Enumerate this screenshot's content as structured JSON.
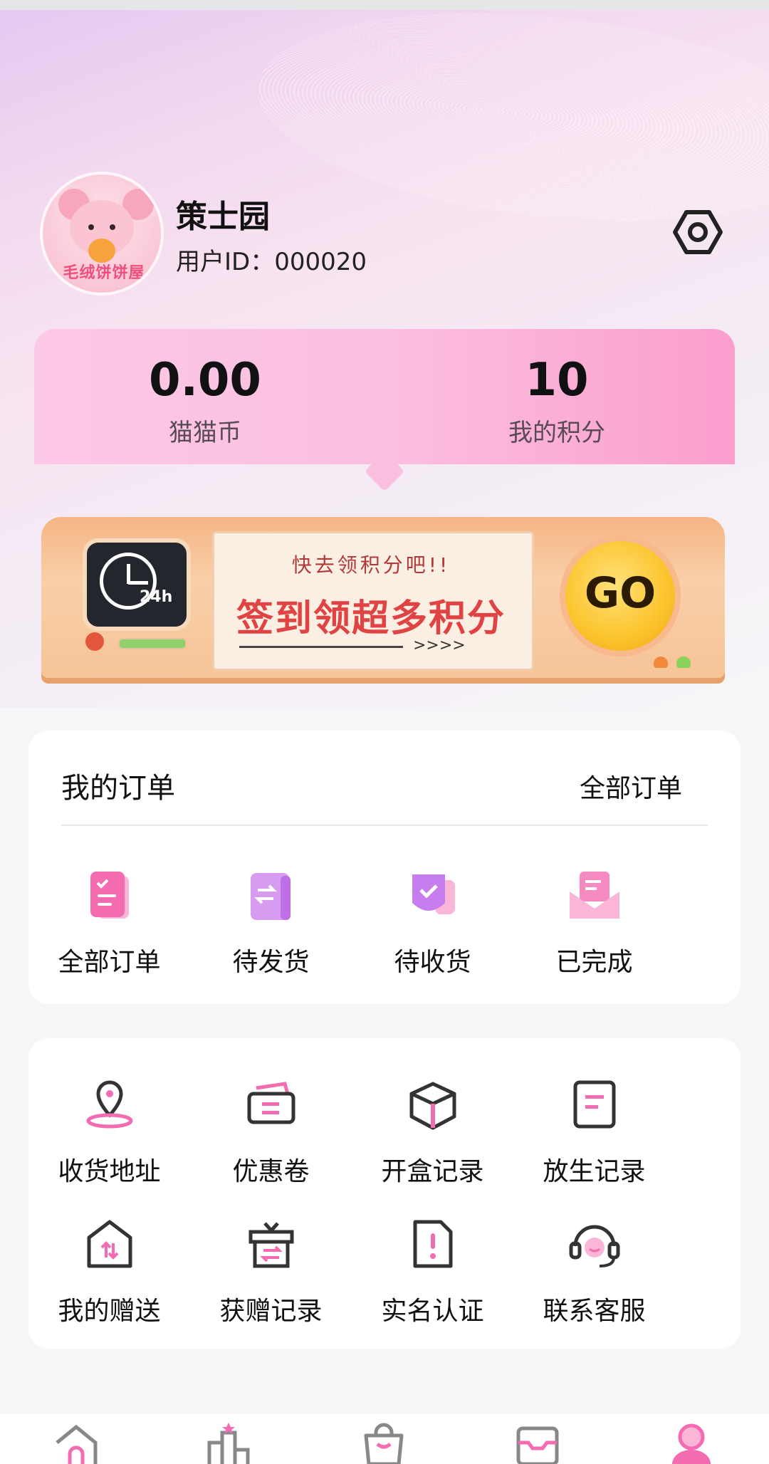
{
  "profile": {
    "name": "策士园",
    "user_id": "用户ID：000020",
    "avatar_text": "毛绒饼饼屋"
  },
  "stats": [
    {
      "value": "0.00",
      "label": "猫猫币"
    },
    {
      "value": "10",
      "label": "我的积分"
    }
  ],
  "banner": {
    "subtitle": "快去领积分吧!!",
    "title": "签到领超多积分",
    "arrows": ">>>>",
    "go_label": "GO",
    "clock_label": "24h"
  },
  "orders": {
    "title": "我的订单",
    "all_link": "全部订单",
    "items": [
      {
        "label": "全部订单",
        "icon": "clipboard-check-icon"
      },
      {
        "label": "待发货",
        "icon": "ship-box-icon"
      },
      {
        "label": "待收货",
        "icon": "receive-shield-icon"
      },
      {
        "label": "已完成",
        "icon": "envelope-done-icon"
      }
    ]
  },
  "services": [
    {
      "label": "收货地址",
      "icon": "location-pin-icon"
    },
    {
      "label": "优惠卷",
      "icon": "coupon-icon"
    },
    {
      "label": "开盒记录",
      "icon": "open-box-icon"
    },
    {
      "label": "放生记录",
      "icon": "document-icon"
    },
    {
      "label": "我的赠送",
      "icon": "gift-send-icon"
    },
    {
      "label": "获赠记录",
      "icon": "gift-received-icon"
    },
    {
      "label": "实名认证",
      "icon": "id-verify-icon"
    },
    {
      "label": "联系客服",
      "icon": "headset-icon"
    }
  ],
  "tabbar": [
    "home-icon",
    "rank-icon",
    "shop-bag-icon",
    "box-icon",
    "profile-icon"
  ],
  "colors": {
    "accent_pink": "#f36bb0",
    "stats_bg": "#fbbfe0",
    "banner_red": "#e04343"
  }
}
